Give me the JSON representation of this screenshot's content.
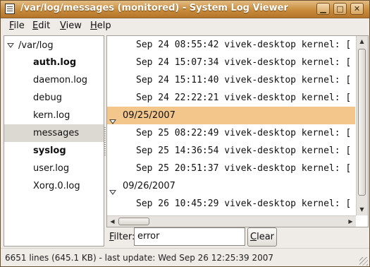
{
  "window": {
    "title": "/var/log/messages (monitored) - System Log Viewer",
    "buttons": [
      "▁",
      "□",
      "✕"
    ]
  },
  "menubar": {
    "items": [
      {
        "label": "ile",
        "mnemonic": "F"
      },
      {
        "label": "dit",
        "mnemonic": "E"
      },
      {
        "label": "iew",
        "mnemonic": "V"
      },
      {
        "label": "elp",
        "mnemonic": "H"
      }
    ]
  },
  "sidebar": {
    "root": "/var/log",
    "items": [
      {
        "label": "auth.log",
        "bold": true,
        "selected": false
      },
      {
        "label": "daemon.log",
        "bold": false,
        "selected": false
      },
      {
        "label": "debug",
        "bold": false,
        "selected": false
      },
      {
        "label": "kern.log",
        "bold": false,
        "selected": false
      },
      {
        "label": "messages",
        "bold": false,
        "selected": true
      },
      {
        "label": "syslog",
        "bold": true,
        "selected": false
      },
      {
        "label": "user.log",
        "bold": false,
        "selected": false
      },
      {
        "label": "Xorg.0.log",
        "bold": false,
        "selected": false
      }
    ]
  },
  "log": {
    "rows": [
      {
        "type": "line",
        "text": "Sep 24 08:55:42 vivek-desktop kernel: ["
      },
      {
        "type": "line",
        "text": "Sep 24 15:07:34 vivek-desktop kernel: ["
      },
      {
        "type": "line",
        "text": "Sep 24 15:11:40 vivek-desktop kernel: ["
      },
      {
        "type": "line",
        "text": "Sep 24 22:22:21 vivek-desktop kernel: ["
      },
      {
        "type": "date",
        "text": "09/25/2007",
        "selected": true
      },
      {
        "type": "line",
        "text": "Sep 25 08:22:49 vivek-desktop kernel: ["
      },
      {
        "type": "line",
        "text": "Sep 25 14:36:54 vivek-desktop kernel: ["
      },
      {
        "type": "line",
        "text": "Sep 25 20:51:37 vivek-desktop kernel: ["
      },
      {
        "type": "date",
        "text": "09/26/2007",
        "selected": false
      },
      {
        "type": "line",
        "text": "Sep 26 10:45:29 vivek-desktop kernel: ["
      }
    ]
  },
  "filter": {
    "label_mnemonic": "F",
    "label_rest": "ilter:",
    "value": "error",
    "clear_label": "lear",
    "clear_mnemonic": "C"
  },
  "statusbar": {
    "text": "6651 lines (645.1 KB) - last update: Wed Sep 26 12:25:39 2007"
  },
  "colors": {
    "titlebar": "#c88c3d",
    "selected_row": "#f3c68b",
    "selected_sidebar": "#dcd8d2"
  }
}
